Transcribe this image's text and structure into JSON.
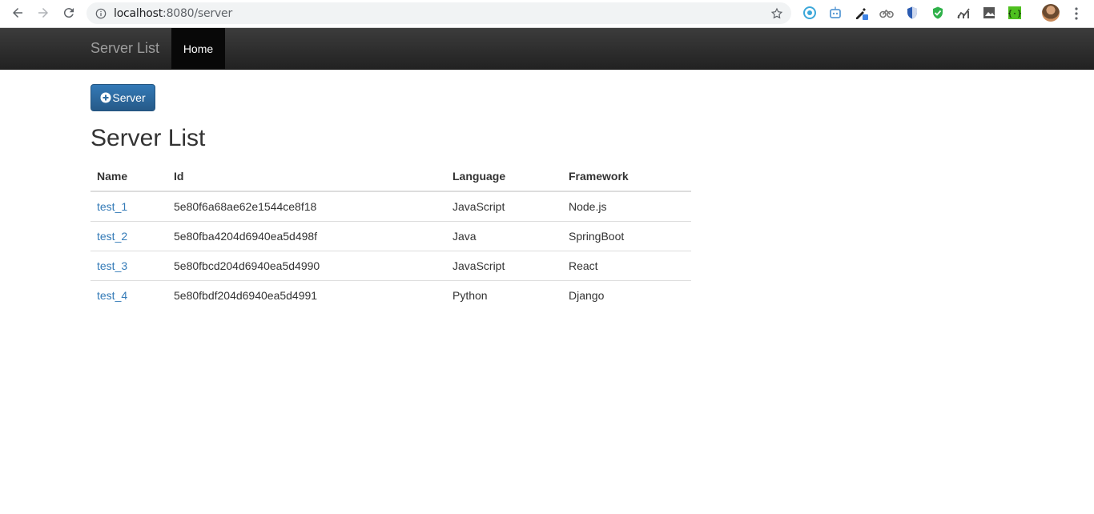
{
  "browser": {
    "url_host": "localhost",
    "url_port_path": ":8080/server",
    "extensions": [
      "compass-icon",
      "robot-icon",
      "eyedropper-icon",
      "bike-icon",
      "shield-icon",
      "green-shield-icon",
      "chart-icon",
      "image-icon",
      "brackets-icon"
    ]
  },
  "navbar": {
    "brand": "Server List",
    "home": "Home"
  },
  "main": {
    "add_button_label": "Server",
    "title": "Server List",
    "table": {
      "headers": [
        "Name",
        "Id",
        "Language",
        "Framework"
      ],
      "rows": [
        {
          "name": "test_1",
          "id": "5e80f6a68ae62e1544ce8f18",
          "language": "JavaScript",
          "framework": "Node.js"
        },
        {
          "name": "test_2",
          "id": "5e80fba4204d6940ea5d498f",
          "language": "Java",
          "framework": "SpringBoot"
        },
        {
          "name": "test_3",
          "id": "5e80fbcd204d6940ea5d4990",
          "language": "JavaScript",
          "framework": "React"
        },
        {
          "name": "test_4",
          "id": "5e80fbdf204d6940ea5d4991",
          "language": "Python",
          "framework": "Django"
        }
      ]
    }
  },
  "colors": {
    "link": "#337ab7",
    "navbar": "#222222",
    "primary_button": "#337ab7"
  }
}
